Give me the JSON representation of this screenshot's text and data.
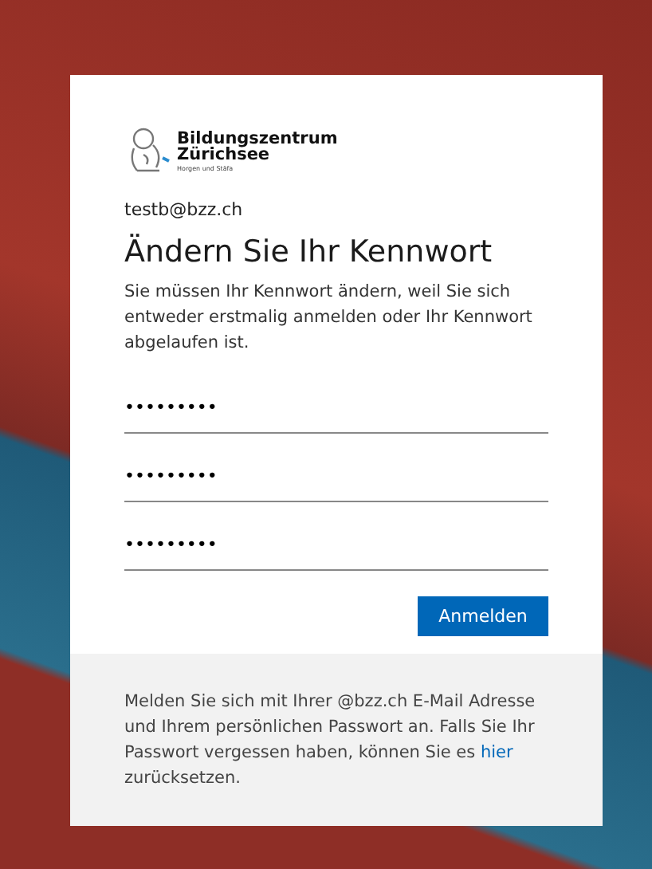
{
  "logo": {
    "name": "Bildungszentrum",
    "name_line_2": "Zürichsee",
    "subtitle": "Horgen und Stäfa"
  },
  "account": "testb@bzz.ch",
  "title": "Ändern Sie Ihr Kennwort",
  "description": "Sie müssen Ihr Kennwort ändern, weil Sie sich entweder erstmalig anmelden oder Ihr Kennwort abgelaufen ist.",
  "fields": [
    {
      "value": "•••••••••"
    },
    {
      "value": "•••••••••"
    },
    {
      "value": "•••••••••"
    }
  ],
  "submit_button": "Anmelden",
  "footer": {
    "text_before": "Melden Sie sich mit Ihrer @bzz.ch E-Mail Adresse und Ihrem persönlichen Passwort an. Falls Sie Ihr Passwort vergessen haben, können Sie es",
    "link": "hier",
    "text_after": "zurücksetzen."
  }
}
